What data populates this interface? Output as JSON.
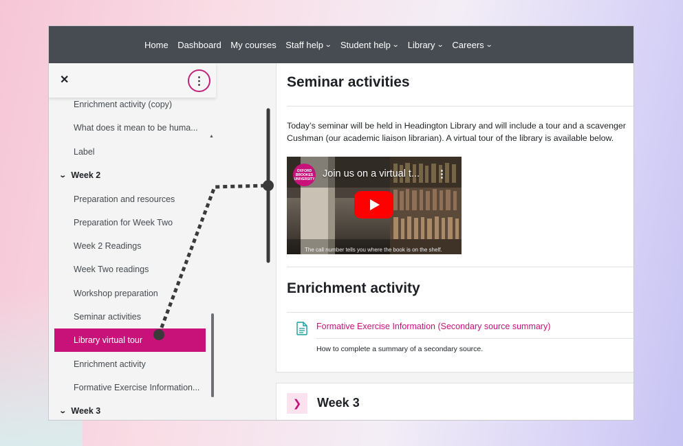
{
  "topnav": {
    "items": [
      {
        "label": "Home",
        "caret": false
      },
      {
        "label": "Dashboard",
        "caret": false
      },
      {
        "label": "My courses",
        "caret": false
      },
      {
        "label": "Staff help",
        "caret": true
      },
      {
        "label": "Student help",
        "caret": true
      },
      {
        "label": "Library",
        "caret": true
      },
      {
        "label": "Careers",
        "caret": true
      }
    ]
  },
  "drawer": {
    "close_glyph": "✕",
    "menu_glyph": "⋮",
    "items": [
      {
        "label": "Enrichment activity (copy)",
        "type": "activity"
      },
      {
        "label": "What does it mean to be huma...",
        "type": "activity"
      },
      {
        "label": "Label",
        "type": "activity"
      },
      {
        "label": "Week 2",
        "type": "section"
      },
      {
        "label": "Preparation and resources",
        "type": "activity"
      },
      {
        "label": "Preparation for Week Two",
        "type": "activity"
      },
      {
        "label": "Week 2 Readings",
        "type": "activity"
      },
      {
        "label": "Week Two readings",
        "type": "activity"
      },
      {
        "label": "Workshop preparation",
        "type": "activity"
      },
      {
        "label": "Seminar activities",
        "type": "activity"
      },
      {
        "label": "Library virtual tour",
        "type": "activity",
        "active": true
      },
      {
        "label": "Enrichment activity",
        "type": "activity"
      },
      {
        "label": "Formative Exercise Information...",
        "type": "activity"
      },
      {
        "label": "Week 3",
        "type": "section"
      }
    ]
  },
  "content": {
    "seminar_heading": "Seminar activities",
    "seminar_text_line1": "Today’s seminar will be held in Headington Library and will include a tour and a scavenger",
    "seminar_text_line2": "Cushman (our academic liaison librarian). A virtual tour of the library is available below.",
    "video": {
      "logo_text": "OXFORD BROOKES UNIVERSITY",
      "title": "Join us on a virtual t...",
      "caption": "The call number tells you where the book is on the shelf."
    },
    "enrichment_heading": "Enrichment activity",
    "activity_link": "Formative Exercise Information (Secondary source summary)",
    "activity_desc": "How to complete a summary of a secondary source.",
    "week3_title": "Week 3"
  },
  "colors": {
    "brand": "#c8127a",
    "navbar": "#474b52",
    "drawer_bg": "#f4f4f5",
    "annotation": "#3a3a3a"
  }
}
